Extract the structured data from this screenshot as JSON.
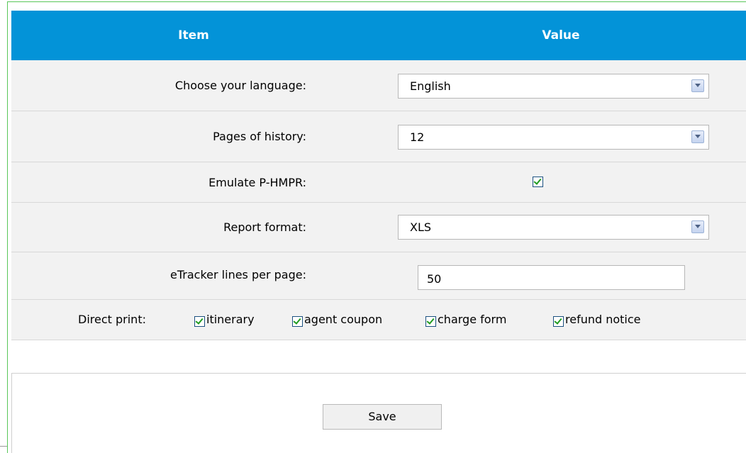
{
  "header": {
    "item_label": "Item",
    "value_label": "Value"
  },
  "settings": {
    "language": {
      "label": "Choose your language:",
      "value": "English"
    },
    "history": {
      "label": "Pages of history:",
      "value": "12"
    },
    "emulate": {
      "label": "Emulate P-HMPR:",
      "checked": true
    },
    "report": {
      "label": "Report format:",
      "value": "XLS"
    },
    "etracker": {
      "label": "eTracker lines per page:",
      "value": "50"
    },
    "direct_print": {
      "label": "Direct print:",
      "options": [
        {
          "label": "itinerary",
          "checked": true
        },
        {
          "label": "agent coupon",
          "checked": true
        },
        {
          "label": "charge form",
          "checked": true
        },
        {
          "label": "refund notice",
          "checked": true
        }
      ]
    }
  },
  "actions": {
    "save_label": "Save"
  },
  "colors": {
    "header_bg": "#0393d8",
    "row_bg": "#f2f2f2",
    "frame_border": "#58c658",
    "check_mark": "#1f9b1f"
  },
  "icons": {
    "dropdown": "chevron-down-icon",
    "checked": "checkmark-icon"
  }
}
